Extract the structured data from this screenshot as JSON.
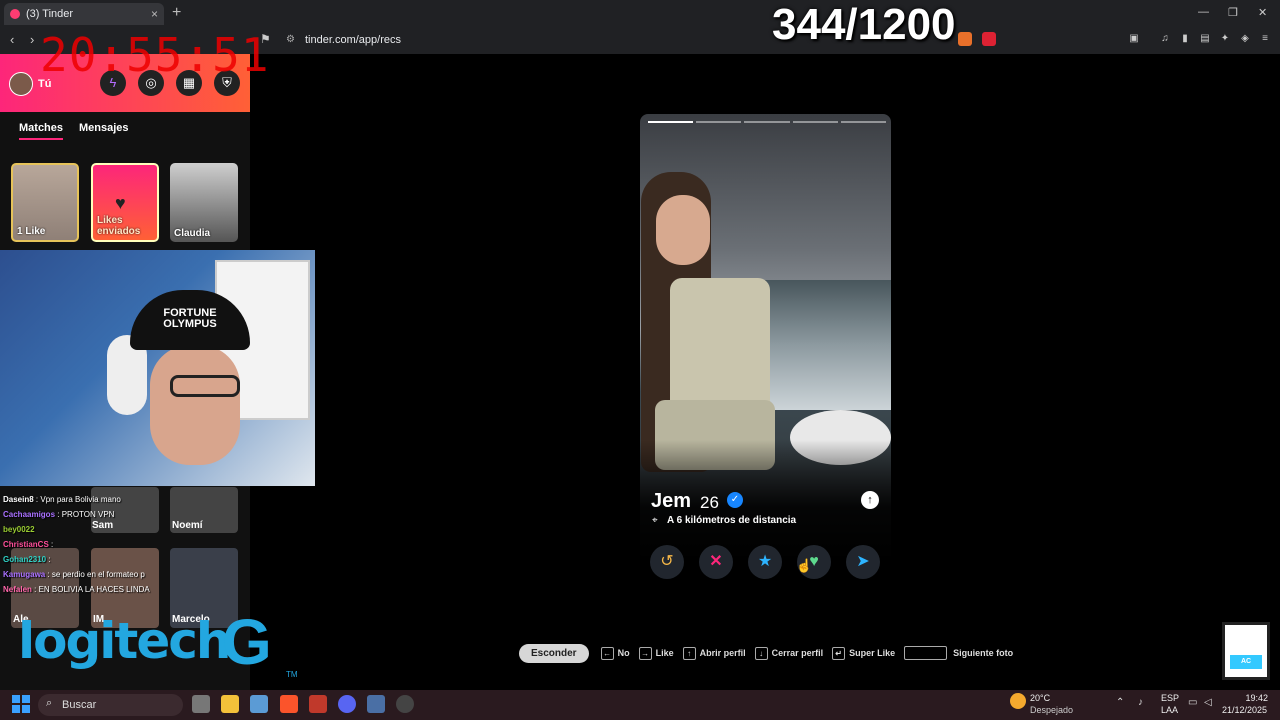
{
  "browser": {
    "tab_title": "(3) Tinder",
    "tab_close": "×",
    "new_tab": "+",
    "url": "tinder.com/app/recs",
    "win_min": "—",
    "win_max": "❐",
    "win_close": "✕"
  },
  "overlay": {
    "clock": "20:55:51",
    "counter": "344/1200"
  },
  "sidebar": {
    "user_label": "Tú",
    "tabs": [
      "Matches",
      "Mensajes"
    ],
    "cards": [
      {
        "label": "1 Like"
      },
      {
        "label": "Likes enviados"
      },
      {
        "label": "Claudia"
      }
    ],
    "lower_tiles": [
      "Sam",
      "Noemí",
      "Ale",
      "IM",
      "Marcelo"
    ]
  },
  "webcam": {
    "cap_text": "FORTUNE OLYMPUS"
  },
  "chat": [
    {
      "user": "Dasein8",
      "msg": ": Vpn para Bolivia mano",
      "color": "#ffffff"
    },
    {
      "user": "Cachaamigos",
      "msg": ": PROTON VPN",
      "color": "#a970ff"
    },
    {
      "user": "bey0022",
      "msg": "",
      "color": "#9acd32"
    },
    {
      "user": "ChristianCS",
      "msg": ":",
      "color": "#ff4f9a"
    },
    {
      "user": "Gohan2310",
      "msg": ":",
      "color": "#2fd1c5"
    },
    {
      "user": "Kamugawa",
      "msg": ": se perdio en el formateo p",
      "color": "#a970ff"
    },
    {
      "user": "Nefalen",
      "msg": ": EN BOLIVIA LA HACES LINDA",
      "color": "#ff66aa"
    }
  ],
  "sponsor": {
    "logo_text": "logitech",
    "g": "G",
    "tm": "TM"
  },
  "profile": {
    "name": "Jem",
    "age": "26",
    "verified_icon": "✓",
    "distance": "A 6 kilómetros de distancia",
    "photo_count": 5,
    "current_photo": 1
  },
  "actions": {
    "rewind": "↺",
    "nope": "✕",
    "super_like": "★",
    "like": "♥",
    "boost": "➤"
  },
  "hints": {
    "hide": "Esconder",
    "no": "No",
    "like": "Like",
    "open_profile": "Abrir perfil",
    "close_profile": "Cerrar perfil",
    "super_like": "Super Like",
    "next_photo": "Siguiente foto"
  },
  "taskbar": {
    "search": "Buscar",
    "weather_temp": "20°C",
    "weather_desc": "Despejado",
    "lang1": "ESP",
    "lang2": "LAA",
    "time": "19:42",
    "date": "21/12/2025"
  },
  "mascot": {
    "label": "AC"
  },
  "colors": {
    "tinder_pink": "#fd267a",
    "tinder_orange": "#ff6036",
    "clock_red": "#ee0000",
    "logitech_blue": "#23a7e0"
  }
}
